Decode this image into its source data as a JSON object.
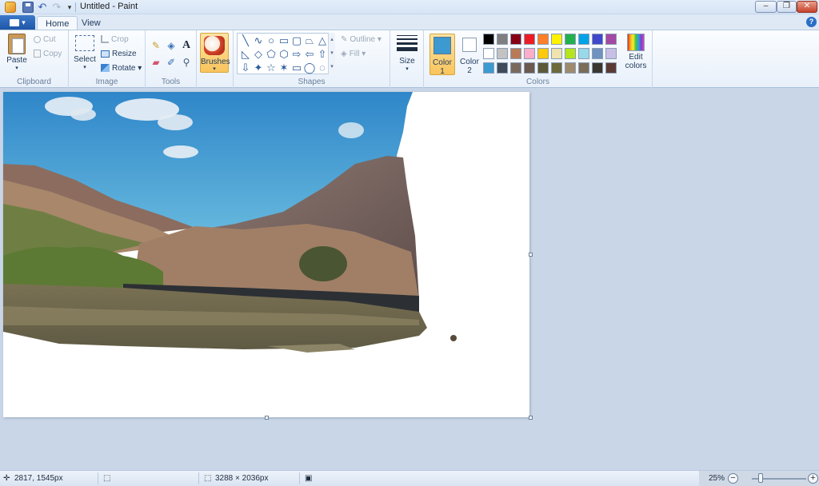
{
  "window": {
    "title": "Untitled - Paint",
    "minimize": "–",
    "maximize": "❐",
    "close": "✕"
  },
  "qat": {
    "undo": "↶",
    "redo": "↷",
    "dropdown": "▾"
  },
  "tabs": {
    "home": "Home",
    "view": "View",
    "help": "?"
  },
  "clipboard": {
    "label": "Clipboard",
    "paste": "Paste",
    "cut": "Cut",
    "copy": "Copy"
  },
  "image": {
    "label": "Image",
    "select": "Select",
    "crop": "Crop",
    "resize": "Resize",
    "rotate": "Rotate"
  },
  "tools": {
    "label": "Tools",
    "pencil": "✎",
    "fill": "◈",
    "text": "A",
    "eraser": "▰",
    "picker": "✐",
    "magnifier": "⚲"
  },
  "brushes": {
    "label": "Brushes"
  },
  "shapes": {
    "label": "Shapes",
    "outline": "Outline",
    "fill": "Fill",
    "items": [
      "╲",
      "∿",
      "○",
      "▭",
      "▢",
      "⏢",
      "△",
      "◺",
      "◇",
      "⬠",
      "⬡",
      "⇨",
      "⇦",
      "⇧",
      "⇩",
      "✦",
      "☆",
      "✶",
      "▭",
      "◯",
      "◌"
    ]
  },
  "size": {
    "label": "Size"
  },
  "colors": {
    "label": "Colors",
    "color1_label": "Color 1",
    "color2_label": "Color 2",
    "edit_label": "Edit colors",
    "color1": "#3d9ad1",
    "color2": "#ffffff",
    "palette": [
      "#000000",
      "#7f7f7f",
      "#880015",
      "#ed1c24",
      "#ff7f27",
      "#fff200",
      "#22b14c",
      "#00a2e8",
      "#3f48cc",
      "#a349a4",
      "#ffffff",
      "#c3c3c3",
      "#b97a57",
      "#ffaec9",
      "#ffc90e",
      "#efe4b0",
      "#b5e61d",
      "#99d9ea",
      "#7092be",
      "#c8bfe7",
      "#3d9ad1",
      "#3f4b5a",
      "#7a6a5e",
      "#6b5a4d",
      "#5e5a39",
      "#6d6a3b",
      "#a08a6e",
      "#7c6d58",
      "#3a3730",
      "#5a3b34"
    ]
  },
  "status": {
    "cursor": "2817, 1545px",
    "selection": "",
    "image_size": "3288 × 2036px",
    "zoom": "25%",
    "zoom_level": 0.25
  }
}
